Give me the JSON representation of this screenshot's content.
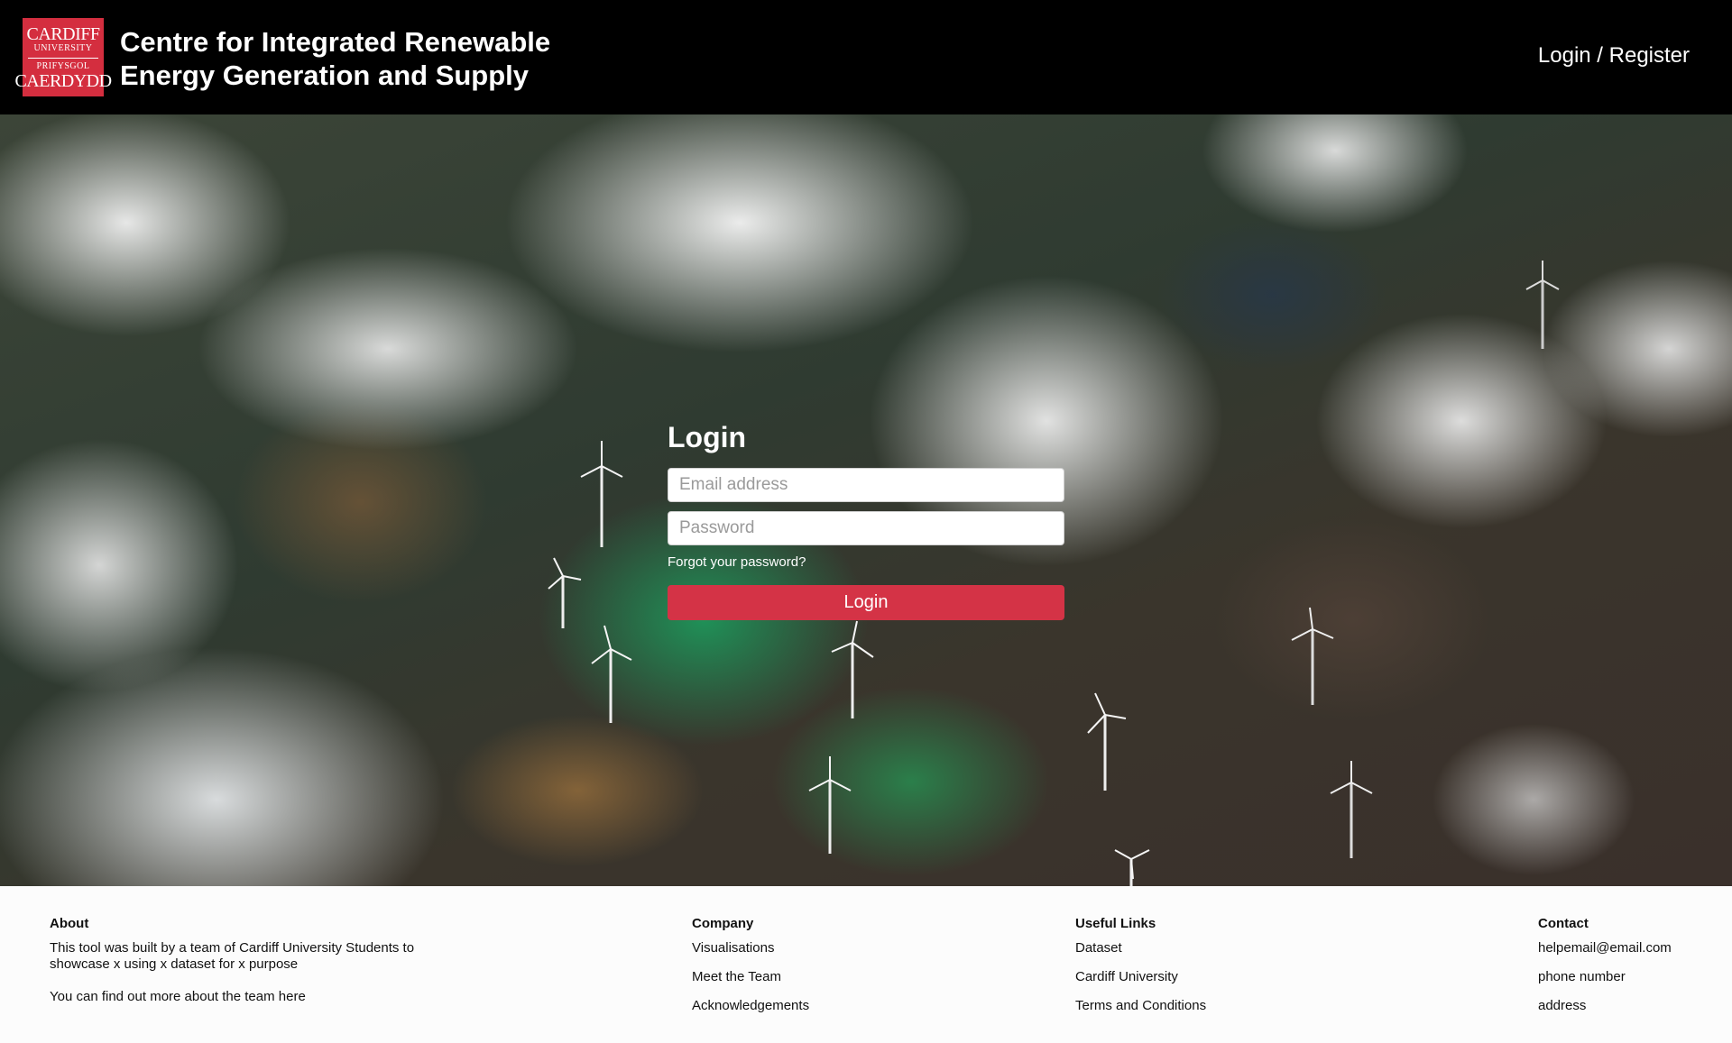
{
  "header": {
    "logo": {
      "line1": "CARDIFF",
      "line2": "UNIVERSITY",
      "line3": "PRIFYSGOL",
      "line4": "CAERDYDD"
    },
    "title_line1": "Centre for Integrated Renewable",
    "title_line2": "Energy Generation and Supply",
    "login_register": "Login / Register"
  },
  "login": {
    "title": "Login",
    "email_placeholder": "Email address",
    "password_placeholder": "Password",
    "forgot_password": "Forgot your password?",
    "button_label": "Login"
  },
  "footer": {
    "about": {
      "heading": "About",
      "text1": "This tool was built by a team of Cardiff University Students to showcase x using x dataset for x purpose",
      "text2": "You can find out more about the team here"
    },
    "company": {
      "heading": "Company",
      "links": [
        "Visualisations",
        "Meet the Team",
        "Acknowledgements"
      ]
    },
    "useful_links": {
      "heading": "Useful Links",
      "links": [
        "Dataset",
        "Cardiff University",
        "Terms and Conditions"
      ]
    },
    "contact": {
      "heading": "Contact",
      "items": [
        "helpemail@email.com",
        "phone number",
        "address"
      ]
    }
  },
  "colors": {
    "header_bg": "#000000",
    "brand_red": "#d42e3f",
    "button_red": "#d43346",
    "footer_bg": "#fcfcfc"
  }
}
